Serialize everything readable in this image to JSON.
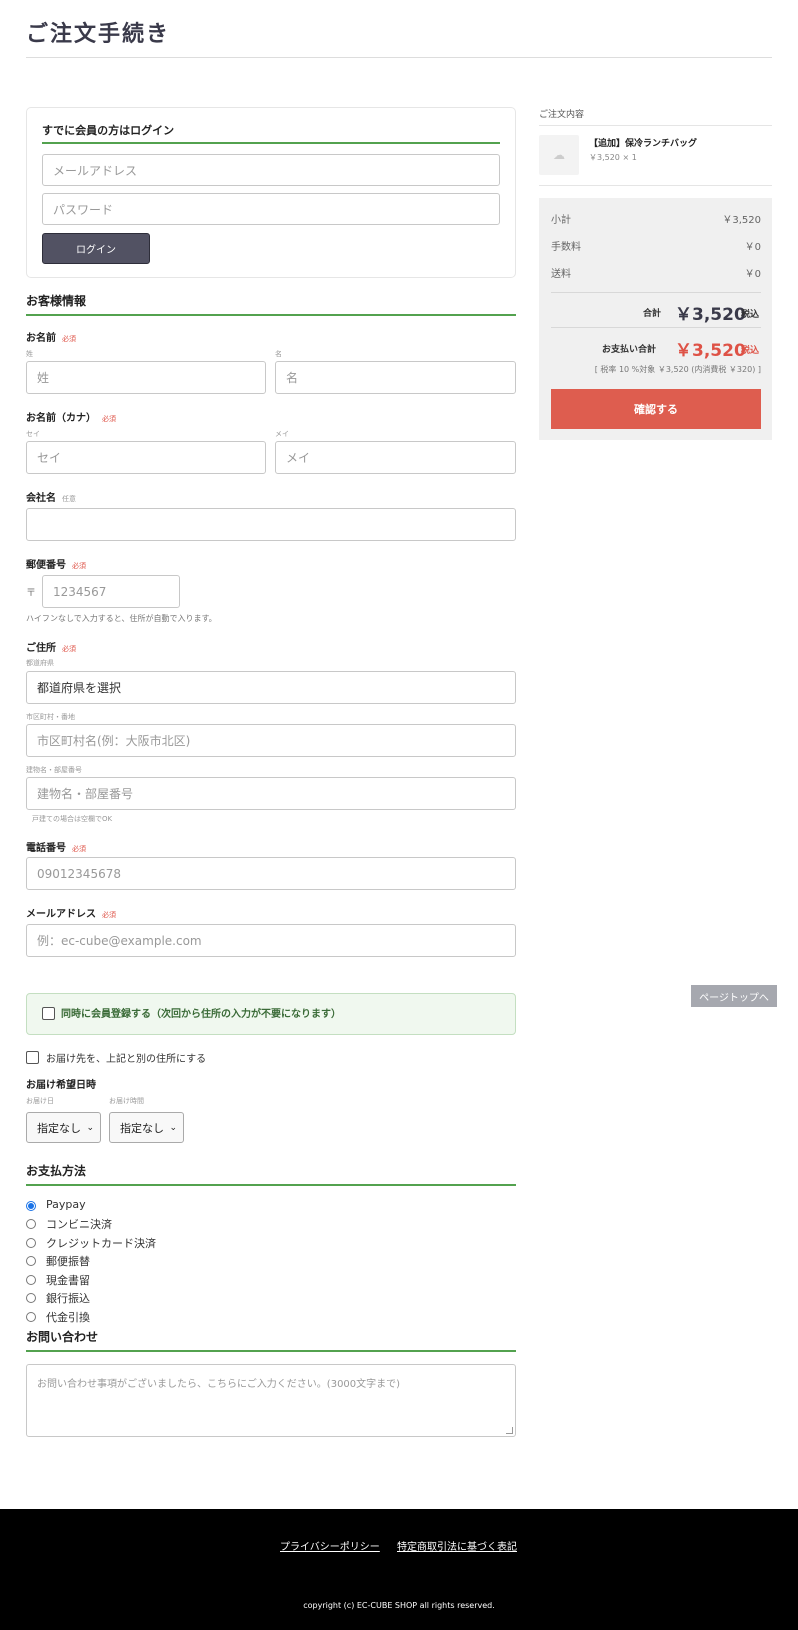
{
  "page": {
    "title": "ご注文手続き"
  },
  "login": {
    "title": "すでに会員の方はログイン",
    "email_placeholder": "メールアドレス",
    "password_placeholder": "パスワード",
    "button": "ログイン"
  },
  "customer": {
    "title": "お客様情報",
    "name": {
      "label": "お名前",
      "required": "必須",
      "last_sub": "姓",
      "first_sub": "名",
      "last_placeholder": "姓",
      "first_placeholder": "名"
    },
    "kana": {
      "label": "お名前（カナ）",
      "required": "必須",
      "last_sub": "セイ",
      "first_sub": "メイ",
      "last_placeholder": "セイ",
      "first_placeholder": "メイ"
    },
    "company": {
      "label": "会社名",
      "optional": "任意"
    },
    "postal": {
      "label": "郵便番号",
      "required": "必須",
      "mark": "〒",
      "placeholder": "1234567",
      "hint": "ハイフンなしで入力すると、住所が自動で入ります。"
    },
    "address": {
      "label": "ご住所",
      "required": "必須",
      "pref_sub": "都道府県",
      "pref_value": "都道府県を選択",
      "city_sub": "市区町村・番地",
      "city_placeholder": "市区町村名(例：大阪市北区)",
      "building_sub": "建物名・部屋番号",
      "building_placeholder": "建物名・部屋番号",
      "building_hint": "戸建ての場合は空欄でOK"
    },
    "phone": {
      "label": "電話番号",
      "required": "必須",
      "placeholder": "09012345678"
    },
    "email": {
      "label": "メールアドレス",
      "required": "必須",
      "placeholder": "例：ec-cube@example.com"
    }
  },
  "member_register": {
    "label": "同時に会員登録する（次回から住所の入力が不要になります）",
    "checked": false
  },
  "separate_shipping": {
    "label": "お届け先を、上記と別の住所にする",
    "checked": false
  },
  "delivery": {
    "title": "お届け希望日時",
    "date_label": "お届け日",
    "date_value": "指定なし",
    "time_label": "お届け時間",
    "time_value": "指定なし"
  },
  "payment": {
    "title": "お支払方法",
    "options": [
      "Paypay",
      "コンビニ決済",
      "クレジットカード決済",
      "郵便振替",
      "現金書留",
      "銀行振込",
      "代金引換"
    ],
    "selected": "Paypay"
  },
  "inquiry": {
    "title": "お問い合わせ",
    "placeholder": "お問い合わせ事項がございましたら、こちらにご入力ください。(3000文字まで)"
  },
  "summary": {
    "title": "ご注文内容",
    "product_name": "【追加】保冷ランチバッグ",
    "product_price": "￥3,520 × 1",
    "subtotal_label": "小計",
    "subtotal": "￥3,520",
    "fee_label": "手数料",
    "fee": "￥0",
    "shipping_label": "送料",
    "shipping": "￥0",
    "total_label": "合計",
    "total": "￥3,520",
    "total_tax": "税込",
    "pay_label": "お支払い合計",
    "pay_total": "￥3,520",
    "pay_tax": "税込",
    "tax_note": "[ 税率 10 %対象 ￥3,520 (内消費税 ￥320) ]",
    "confirm_button": "確認する"
  },
  "page_top": "ページトップへ",
  "footer": {
    "links": [
      "プライバシーポリシー",
      "特定商取引法に基づく表記"
    ],
    "copyright": "copyright (c) EC-CUBE SHOP all rights reserved."
  }
}
